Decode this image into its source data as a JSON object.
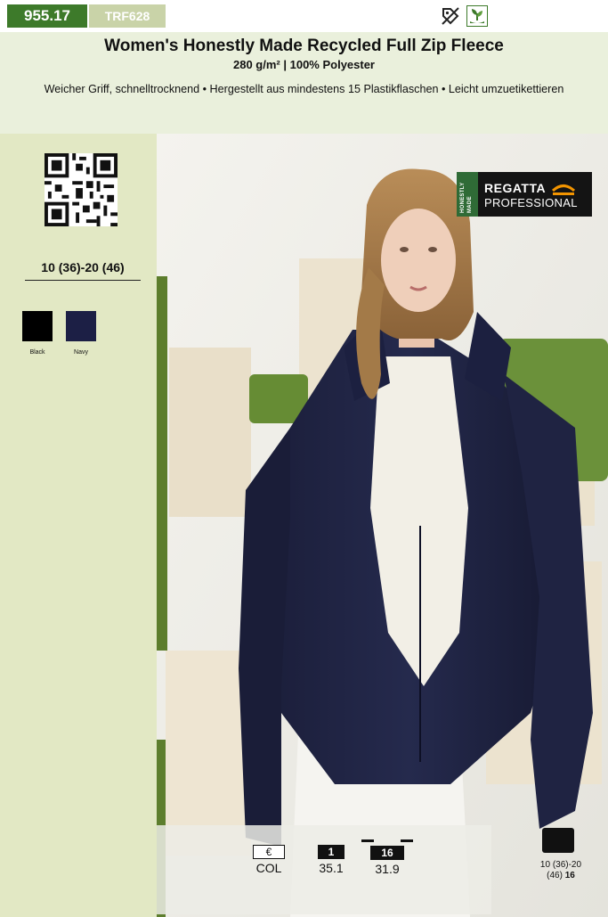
{
  "header": {
    "article_number": "955.17",
    "article_code": "TRF628",
    "title": "Women's Honestly Made Recycled Full Zip Fleece",
    "subtitle": "280 g/m² | 100% Polyester",
    "description": "Weicher Griff, schnelltrocknend • Hergestellt aus mindestens 15 Plastikflaschen • Leicht umzuetikettieren",
    "icons": [
      "no-label-tag-icon",
      "recycled-plant-icon"
    ]
  },
  "sidebar": {
    "qr_code": "qr-code-icon",
    "size_range": "10 (36)-20 (46)",
    "colors": [
      {
        "label": "Black",
        "hex": "#000000"
      },
      {
        "label": "Navy",
        "hex": "#1c1f45"
      }
    ]
  },
  "brand": {
    "badge": "HONESTLY MADE",
    "name_line1": "REGATTA",
    "name_line2": "PROFESSIONAL"
  },
  "pricing": {
    "currency_label": "€",
    "col_label": "COL",
    "tier1_qty": "1",
    "tier1_price": "35.1",
    "tier2_qty": "16",
    "tier2_price": "31.9"
  },
  "packaging": {
    "sizes": "10 (36)-20",
    "sizes_cont": "(46)",
    "carton_qty": "16"
  },
  "colors": {
    "accent_green": "#3d7a2a",
    "code_green": "#c9d3a8",
    "sidebar_bg": "#e2e8c4"
  }
}
